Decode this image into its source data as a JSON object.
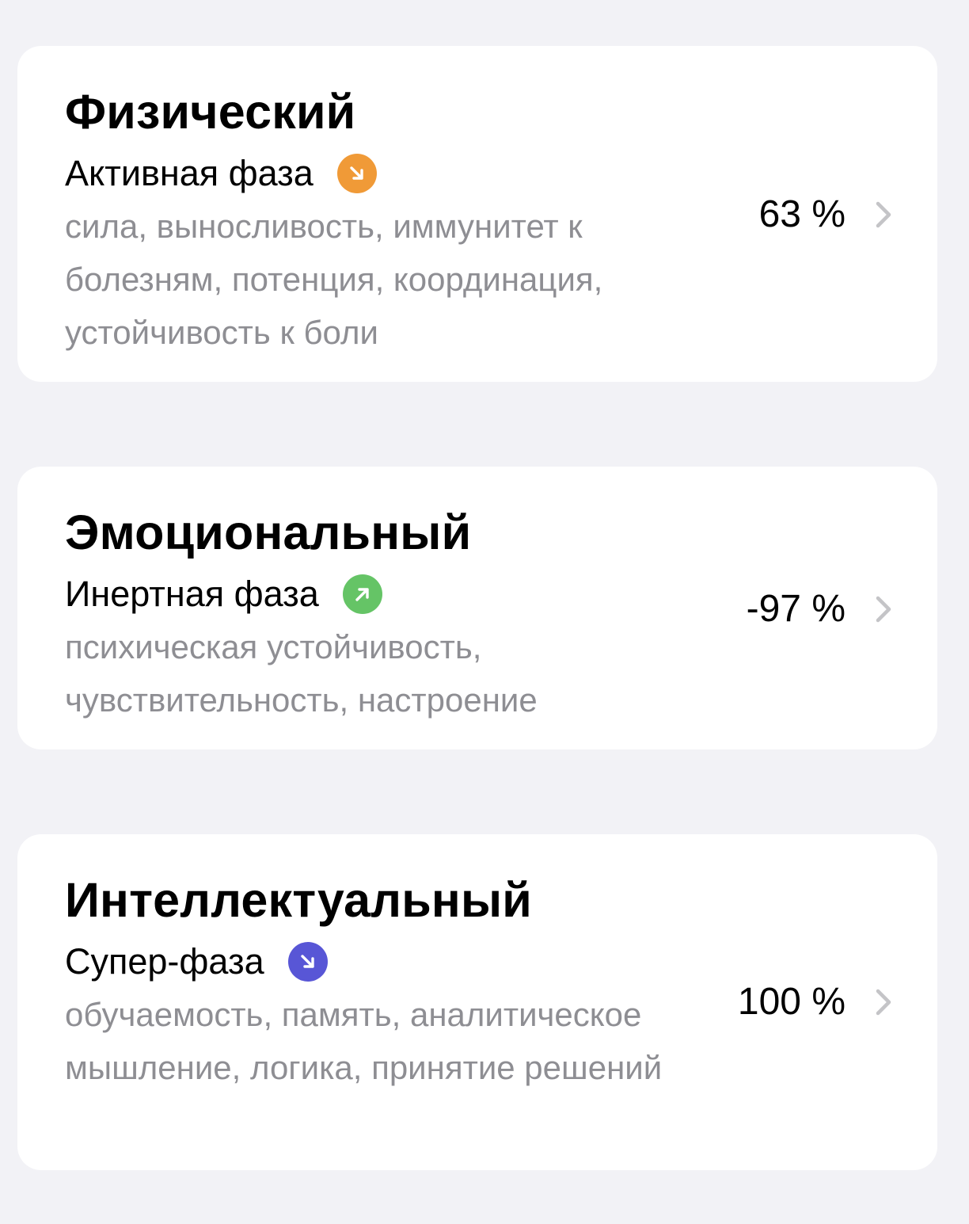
{
  "cards": [
    {
      "title": "Физический",
      "phase": "Активная фаза",
      "phase_icon": "arrow-down-right-icon",
      "phase_color": "#F09A37",
      "description": "сила, выносливость, иммунитет к болезням, потенция, координация, устойчивость к боли",
      "value": "63 %"
    },
    {
      "title": "Эмоциональный",
      "phase": "Инертная фаза",
      "phase_icon": "arrow-up-right-icon",
      "phase_color": "#65C466",
      "description": "психическая устойчивость, чувствительность, настроение",
      "value": "-97 %"
    },
    {
      "title": "Интеллектуальный",
      "phase": "Супер-фаза",
      "phase_icon": "arrow-down-right-icon",
      "phase_color": "#5856D6",
      "description": "обучаемость, память, аналитическое мышление, логика, принятие решений",
      "value": "100 %"
    }
  ],
  "colors": {
    "background": "#F2F2F6",
    "card": "#FFFFFF",
    "secondary_text": "#8E8E93",
    "chevron": "#C4C4C7"
  }
}
